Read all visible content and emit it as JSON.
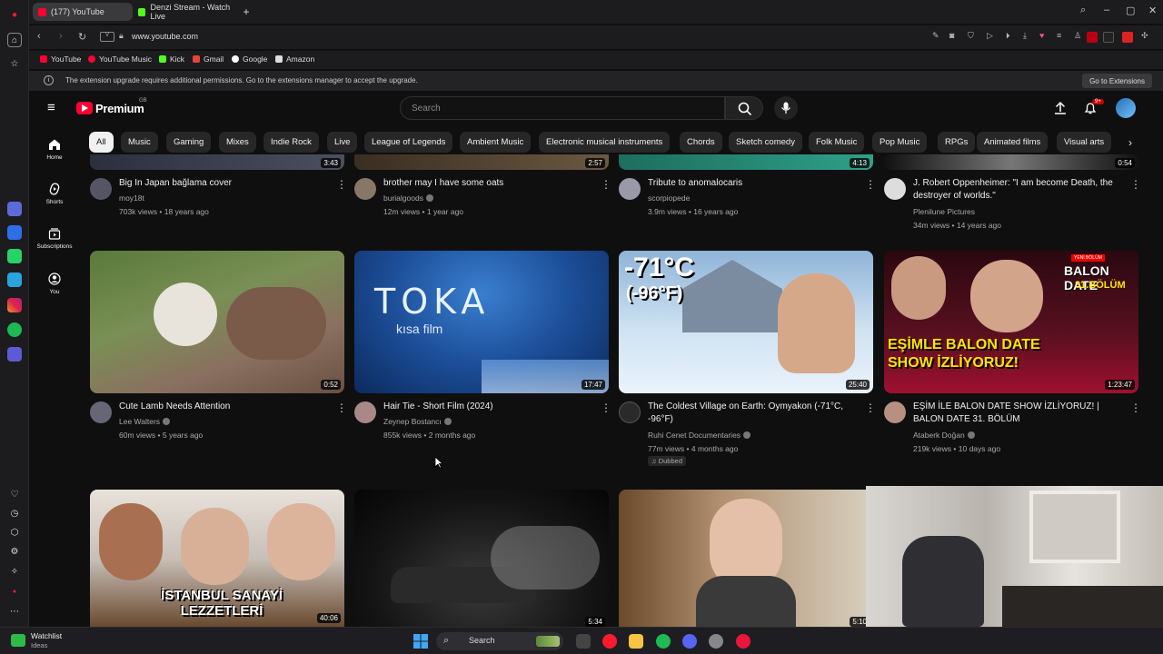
{
  "browser": {
    "tabs": [
      {
        "title": "(177) YouTube",
        "active": true
      },
      {
        "title": "Denzi Stream - Watch Live"
      }
    ],
    "url": "www.youtube.com",
    "bookmarks": [
      "YouTube",
      "YouTube Music",
      "Kick",
      "Gmail",
      "Google",
      "Amazon"
    ],
    "notice": "The extension upgrade requires additional permissions. Go to the extensions manager to accept the upgrade.",
    "notice_button": "Go to Extensions"
  },
  "youtube": {
    "logo": "Premium",
    "logo_sup": "GB",
    "search_placeholder": "Search",
    "notification_count": "9+",
    "guide": [
      {
        "label": "Home",
        "icon": "home-icon"
      },
      {
        "label": "Shorts",
        "icon": "shorts-icon"
      },
      {
        "label": "Subscriptions",
        "icon": "subscriptions-icon"
      },
      {
        "label": "You",
        "icon": "you-icon"
      }
    ],
    "chips": [
      "All",
      "Music",
      "Gaming",
      "Mixes",
      "Indie Rock",
      "Live",
      "League of Legends",
      "Ambient Music",
      "Electronic musical instruments",
      "Chords",
      "Sketch comedy",
      "Folk Music",
      "Pop Music",
      "RPGs",
      "Animated films",
      "Visual arts"
    ],
    "row1": [
      {
        "title": "Big In Japan bağlama cover",
        "channel": "moy18t",
        "verified": false,
        "meta": "703k views • 18 years ago",
        "duration": "3:43"
      },
      {
        "title": "brother may I have some oats",
        "channel": "burialgoods",
        "verified": true,
        "meta": "12m views • 1 year ago",
        "duration": "2:57"
      },
      {
        "title": "Tribute to anomalocaris",
        "channel": "scorpiopede",
        "verified": false,
        "meta": "3.9m views • 16 years ago",
        "duration": "4:13"
      },
      {
        "title": "J. Robert Oppenheimer: \"I am become Death, the destroyer of worlds.\"",
        "channel": "Plenilune Pictures",
        "verified": false,
        "meta": "34m views • 14 years ago",
        "duration": "0:54"
      }
    ],
    "row2": [
      {
        "title": "Cute Lamb Needs Attention",
        "channel": "Lee Walters",
        "verified": true,
        "meta": "60m views • 5 years ago",
        "duration": "0:52"
      },
      {
        "title": "Hair Tie - Short Film (2024)",
        "channel": "Zeynep Bostancı",
        "verified": true,
        "meta": "855k views • 2 months ago",
        "duration": "17:47",
        "thumb_text": "TOKA",
        "thumb_sub": "kısa film"
      },
      {
        "title": "The Coldest Village on Earth: Oymyakon (-71°C, -96°F)",
        "channel": "Ruhi Cenet Documentaries",
        "verified": true,
        "meta": "77m views • 4 months ago",
        "badge": "Dubbed",
        "duration": "25:40",
        "thumb_text": "-71°C",
        "thumb_sub": "(-96°F)"
      },
      {
        "title": "EŞİM İLE BALON DATE SHOW İZLİYORUZ! | BALON DATE 31. BÖLÜM",
        "channel": "Ataberk Doğan",
        "verified": true,
        "meta": "219k views • 10 days ago",
        "duration": "1:23:47",
        "thumb_top": "YENİ BÖLÜM",
        "thumb_title": "BALON DATE",
        "thumb_ep": "31.BÖLÜM",
        "thumb_caption": "EŞİMLE BALON DATE SHOW İZLİYORUZ!"
      }
    ],
    "row3": [
      {
        "duration": "40:06",
        "thumb_text": "İSTANBUL SANAYİ LEZZETLERİ"
      },
      {
        "duration": "5:34"
      },
      {
        "duration": "5:10"
      }
    ]
  },
  "taskbar": {
    "widget_title": "Watchlist",
    "widget_sub": "Ideas",
    "search_label": "Search"
  },
  "colors": {
    "accent": "#ff0033",
    "bg": "#0f0f0f",
    "chip": "#272727"
  }
}
